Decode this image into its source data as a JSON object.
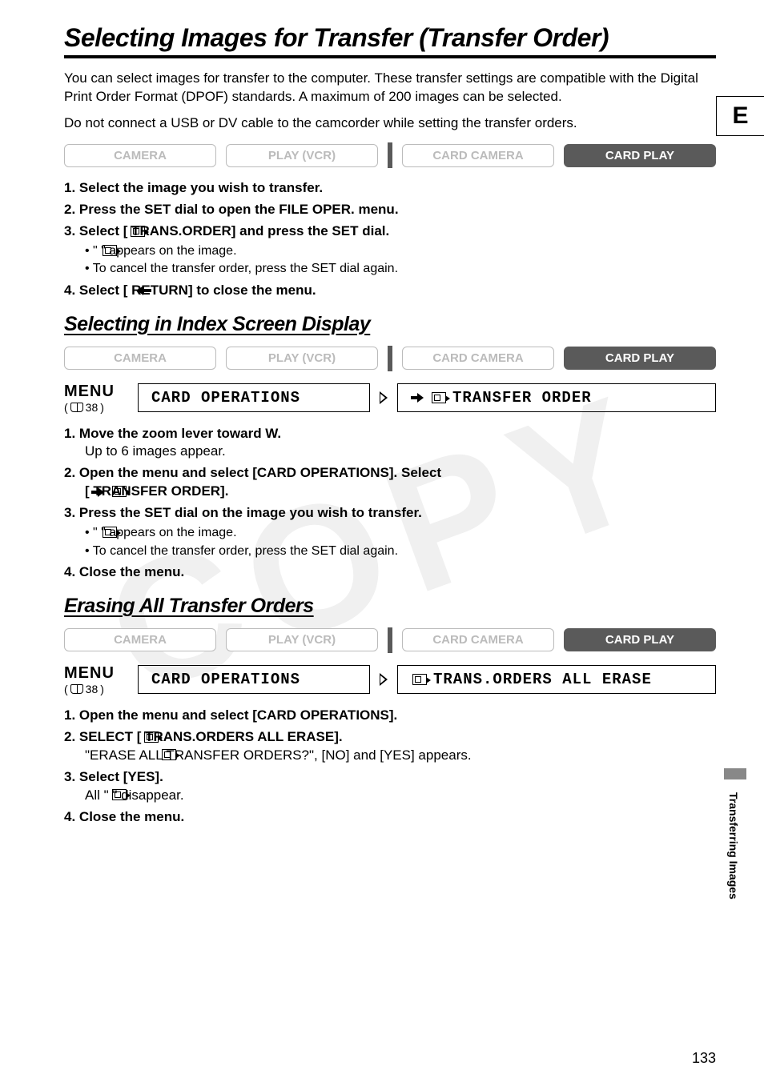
{
  "lang_tab": "E",
  "side_label": "Transferring Images",
  "title": "Selecting Images for Transfer (Transfer Order)",
  "intro1": "You can select images for transfer to the computer. These transfer settings are compatible with the Digital Print Order Format (DPOF) standards. A maximum of 200 images can be selected.",
  "intro2": "Do not connect a USB or DV cable to the camcorder while setting the transfer orders.",
  "modes": {
    "camera": "CAMERA",
    "play_vcr": "PLAY (VCR)",
    "card_camera": "CARD CAMERA",
    "card_play": "CARD PLAY"
  },
  "section1_steps": {
    "s1": "Select the image you wish to transfer.",
    "s2": "Press the SET dial to open the FILE OPER. menu.",
    "s3": "Select [     TRANS.ORDER] and press the SET dial.",
    "s3_b1": "\"     \" appears on the image.",
    "s3_b2": "To cancel the transfer order, press the SET dial again.",
    "s4": "Select [     RETURN] to close the menu."
  },
  "section2_title": "Selecting in Index Screen Display",
  "menu_label": "MENU",
  "menu_ref": "38",
  "menu_box1": "CARD OPERATIONS",
  "menu_box2a": "TRANSFER ORDER",
  "section2_steps": {
    "s1": "Move the zoom lever toward W.",
    "s1_sub": "Up to 6 images appear.",
    "s2a": "Open the menu and select [CARD OPERATIONS]. Select",
    "s2b": "[         TRANSFER ORDER].",
    "s3": "Press the SET dial on the image you wish to transfer.",
    "s3_b1": "\"     \" appears on the image.",
    "s3_b2": "To cancel the transfer order, press the SET dial again.",
    "s4": "Close the menu."
  },
  "section3_title": "Erasing All Transfer Orders",
  "menu_box2b": "TRANS.ORDERS ALL ERASE",
  "section3_steps": {
    "s1": "Open the menu and select [CARD OPERATIONS].",
    "s2": "SELECT [     TRANS.ORDERS ALL ERASE].",
    "s2_sub": "\"ERASE ALL      TRANSFER ORDERS?\", [NO] and [YES] appears.",
    "s3": "Select [YES].",
    "s3_sub": "All \"     \" disappear.",
    "s4": "Close the menu."
  },
  "watermark": "COPY",
  "page_num": "133"
}
